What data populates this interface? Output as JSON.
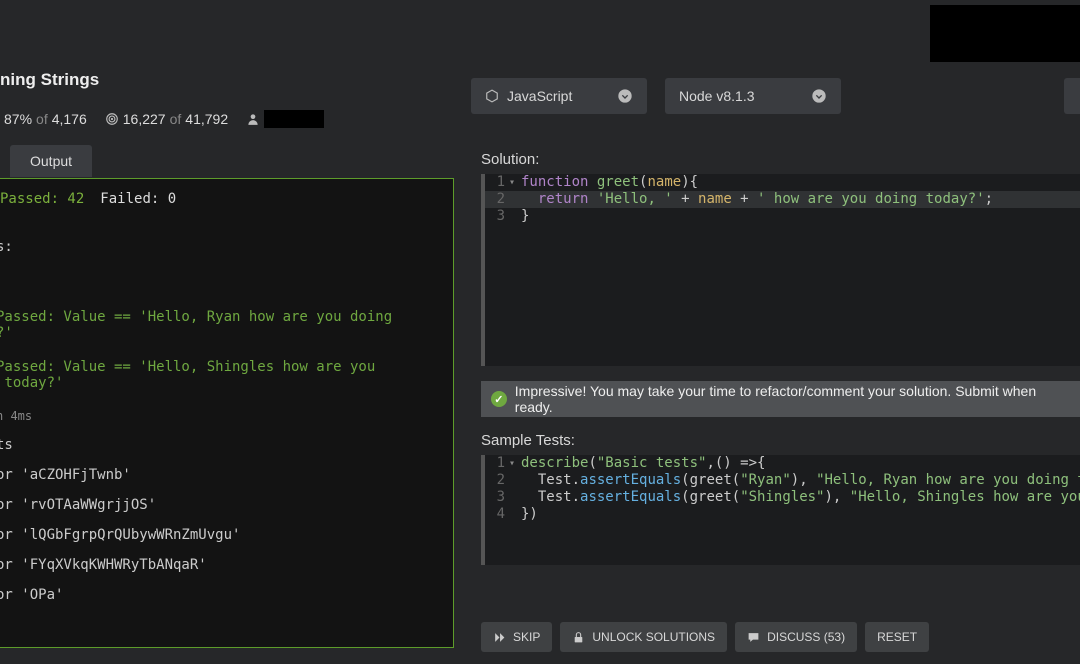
{
  "header": {
    "title": "ning Strings",
    "pct": "87%",
    "of1": "of",
    "total1": "4,176",
    "completed": "16,227",
    "of2": "of",
    "total2": "41,792"
  },
  "dropdowns": {
    "language": "JavaScript",
    "runtime": "Node v8.1.3"
  },
  "tabs": {
    "output": "Output"
  },
  "output": {
    "passed_label": "Passed: 42",
    "failed_label": "Failed: 0",
    "heading1": "s:",
    "pass1": "Passed: Value == 'Hello, Ryan how are you doing\n?'",
    "pass2": "Passed: Value == 'Hello, Shingles how are you\n today?'",
    "timing": "n 4ms",
    "heading2": "ts",
    "t1": "or 'aCZOHFjTwnb'",
    "t2": "or 'rvOTAaWWgrjjOS'",
    "t3": "or 'lQGbFgrpQrQUbywWRnZmUvgu'",
    "t4": "or 'FYqXVkqKWHWRyTbANqaR'",
    "t5": "or 'OPa'"
  },
  "solution": {
    "label": "Solution:",
    "line1_a": "function",
    "line1_b": "greet",
    "line1_c": "name",
    "line1_raw_open": "(",
    "line1_raw_close": "){",
    "line2_a": "return",
    "line2_s1": "'Hello, '",
    "line2_plus": " + ",
    "line2_v": "name",
    "line2_plus2": " + ",
    "line2_s2": "' how are you doing today?'",
    "line2_semi": ";",
    "line3": "}"
  },
  "banner": "Impressive! You may take your time to refactor/comment your solution. Submit when ready.",
  "tests": {
    "label": "Sample Tests:",
    "l1_a": "describe",
    "l1_b": "(",
    "l1_c": "\"Basic tests\"",
    "l1_d": ",() =>{",
    "l2_a": "  Test.",
    "l2_b": "assertEquals",
    "l2_c": "(greet(",
    "l2_d": "\"Ryan\"",
    "l2_e": "), ",
    "l2_f": "\"Hello, Ryan how are you doing today?\"",
    "l2_g": ")",
    "l3_a": "  Test.",
    "l3_b": "assertEquals",
    "l3_c": "(greet(",
    "l3_d": "\"Shingles\"",
    "l3_e": "), ",
    "l3_f": "\"Hello, Shingles how are you doing today?\"",
    "l3_g": ")",
    "l4": "})"
  },
  "buttons": {
    "skip": "SKIP",
    "unlock": "UNLOCK SOLUTIONS",
    "discuss": "DISCUSS (53)",
    "reset": "RESET"
  }
}
